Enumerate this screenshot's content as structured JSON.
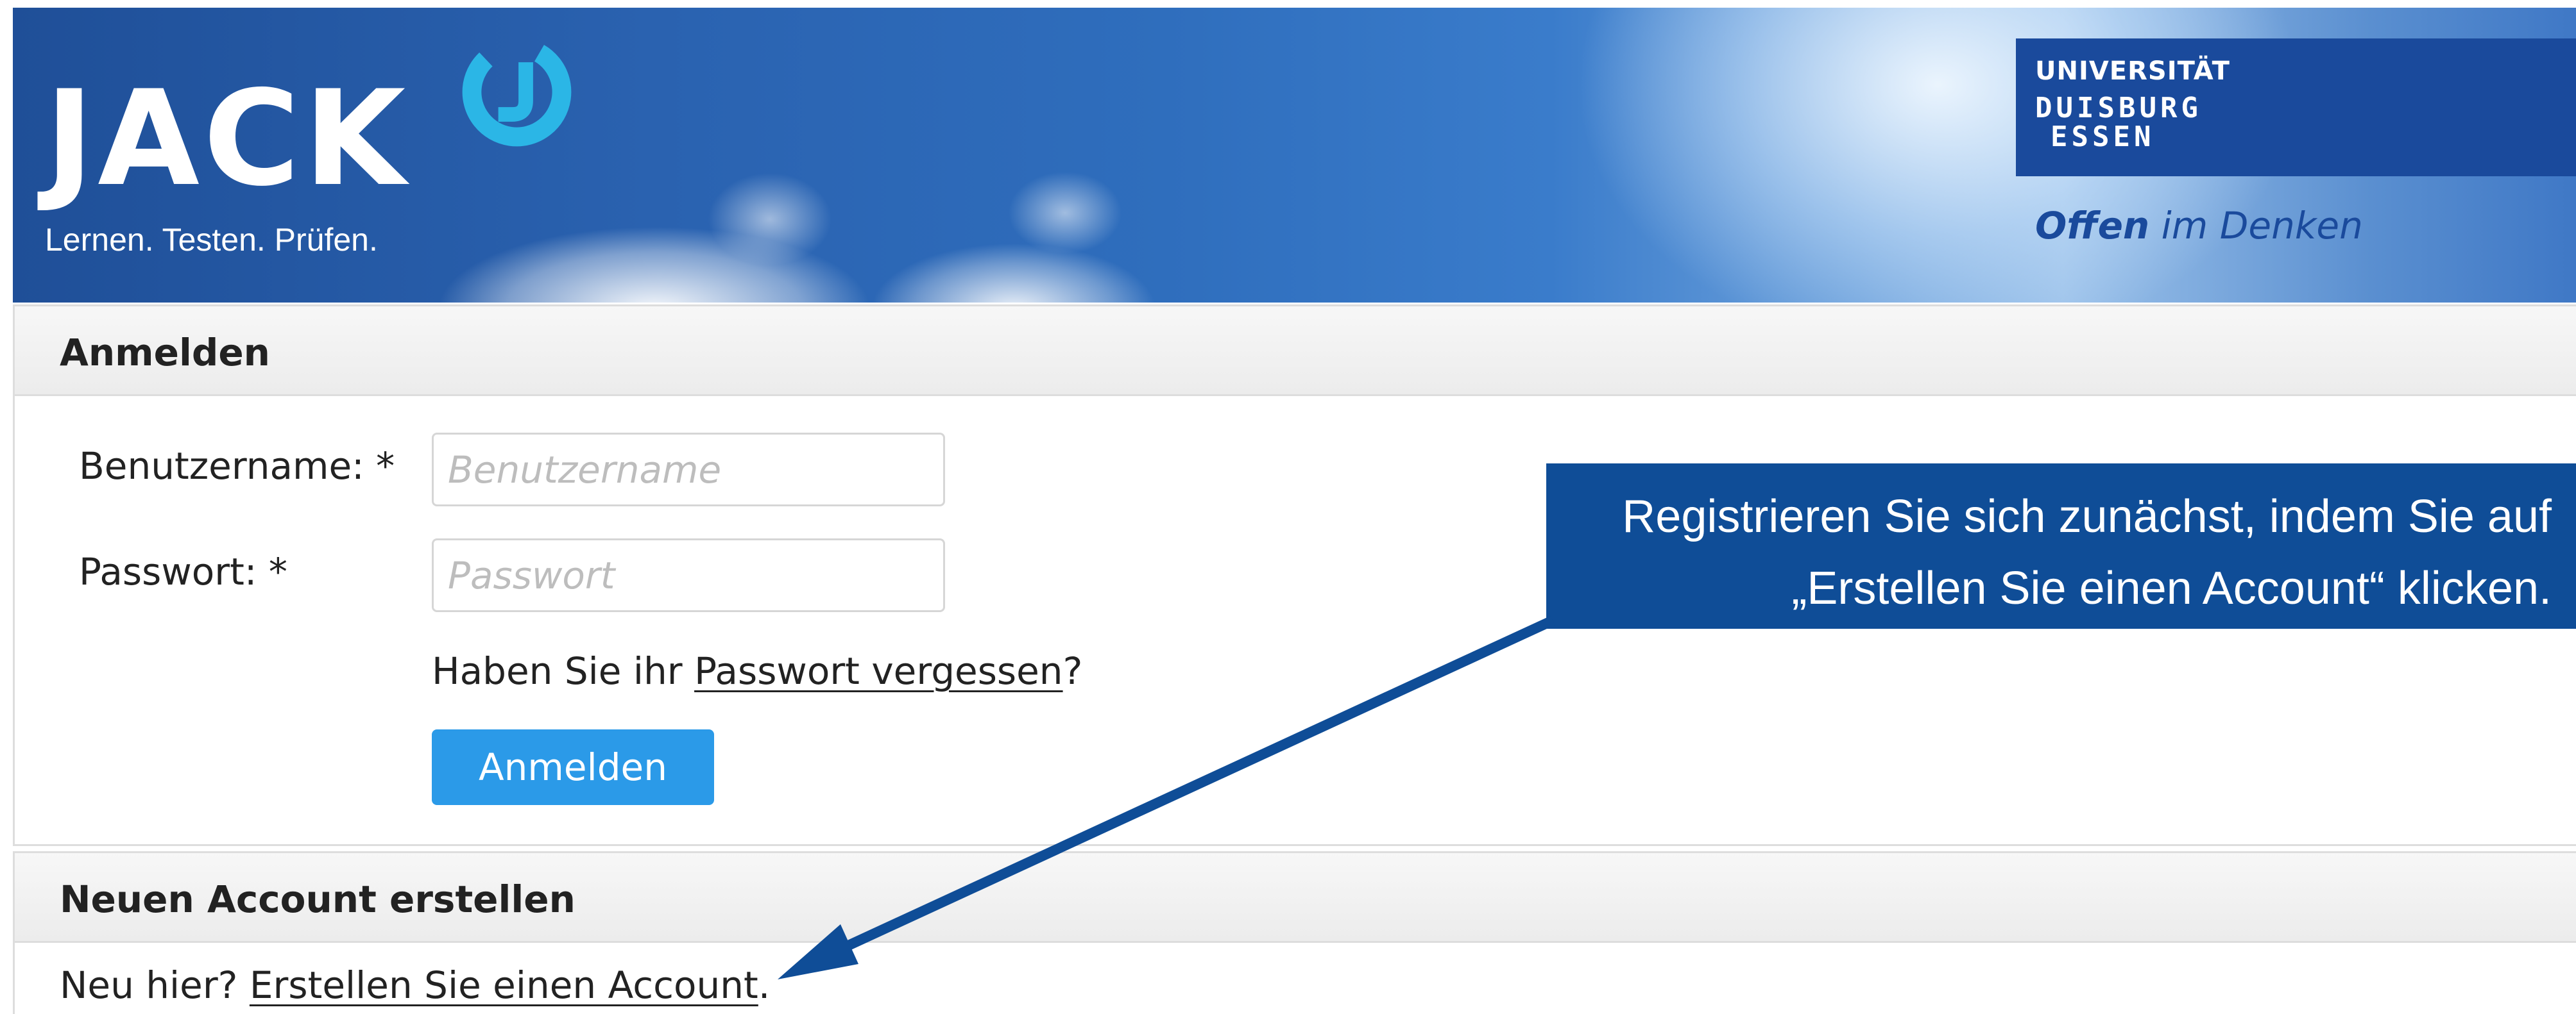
{
  "header": {
    "app_name": "JACK",
    "tagline": "Lernen. Testen. Prüfen.",
    "university": {
      "line1": "UNIVERSITÄT",
      "duisburg": "DUISBURG",
      "essen": "ESSEN",
      "slogan_bold": "Offen",
      "slogan_rest": " im Denken"
    }
  },
  "login": {
    "title": "Anmelden",
    "username_label": "Benutzername: *",
    "username_placeholder": "Benutzername",
    "password_label": "Passwort: *",
    "password_placeholder": "Passwort",
    "forgot_prefix": "Haben Sie ihr ",
    "forgot_link": "Passwort vergessen",
    "forgot_suffix": "?",
    "submit_label": "Anmelden"
  },
  "account": {
    "title": "Neuen Account erstellen",
    "prefix": "Neu hier? ",
    "link": "Erstellen Sie einen Account",
    "suffix": "."
  },
  "callout": {
    "line1": "Registrieren Sie sich zunächst, indem Sie auf",
    "line2": "„Erstellen Sie einen Account“ klicken."
  },
  "colors": {
    "brand_blue": "#1a4a9c",
    "button_blue": "#2b9ae8",
    "callout_blue": "#0f4d97",
    "logo_accent": "#2bb6e6"
  },
  "icons": {
    "logo_mark": "jack-logo-icon"
  }
}
